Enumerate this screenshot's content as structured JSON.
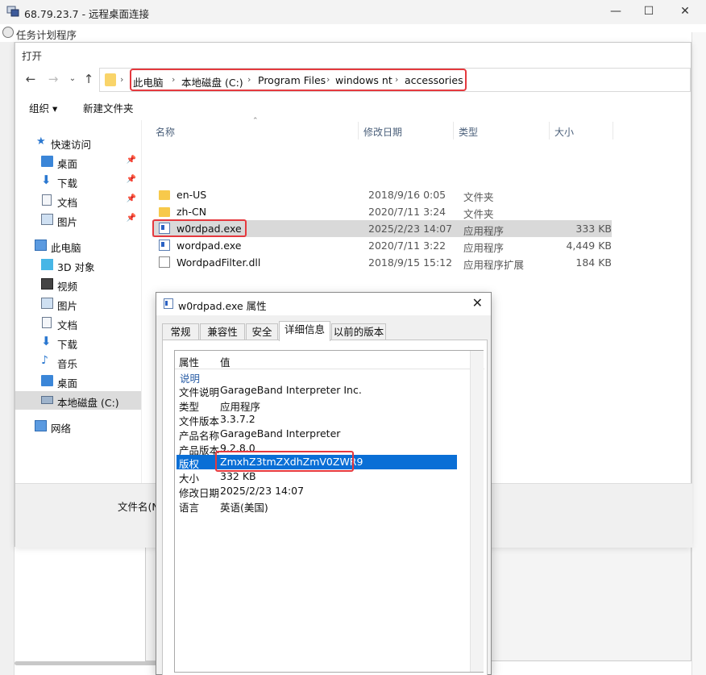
{
  "rdp": {
    "title": "68.79.23.7 - 远程桌面连接",
    "minimize": "—",
    "maximize": "☐",
    "close": "✕"
  },
  "bg_app": {
    "title": "任务计划程序"
  },
  "open_dialog": {
    "title": "打开",
    "breadcrumbs": [
      "此电脑",
      "本地磁盘 (C:)",
      "Program Files",
      "windows nt",
      "accessories"
    ],
    "toolbar": {
      "organize": "组织 ▾",
      "new_folder": "新建文件夹"
    },
    "nav": {
      "quick_access": "快速访问",
      "desktop": "桌面",
      "downloads": "下载",
      "documents": "文档",
      "pictures": "图片",
      "this_pc": "此电脑",
      "objects3d": "3D 对象",
      "videos": "视频",
      "pictures2": "图片",
      "documents2": "文档",
      "downloads2": "下载",
      "music": "音乐",
      "desktop2": "桌面",
      "local_disk": "本地磁盘 (C:)",
      "network": "网络"
    },
    "columns": {
      "name": "名称",
      "date": "修改日期",
      "type": "类型",
      "size": "大小"
    },
    "files": [
      {
        "name": "en-US",
        "date": "2018/9/16 0:05",
        "type": "文件夹",
        "size": ""
      },
      {
        "name": "zh-CN",
        "date": "2020/7/11 3:24",
        "type": "文件夹",
        "size": ""
      },
      {
        "name": "w0rdpad.exe",
        "date": "2025/2/23 14:07",
        "type": "应用程序",
        "size": "333 KB"
      },
      {
        "name": "wordpad.exe",
        "date": "2020/7/11 3:22",
        "type": "应用程序",
        "size": "4,449 KB"
      },
      {
        "name": "WordpadFilter.dll",
        "date": "2018/9/15 15:12",
        "type": "应用程序扩展",
        "size": "184 KB"
      }
    ],
    "filename_label": "文件名(N"
  },
  "props": {
    "title": "w0rdpad.exe 属性",
    "close": "✕",
    "tabs": [
      "常规",
      "兼容性",
      "安全",
      "详细信息",
      "以前的版本"
    ],
    "header": {
      "property": "属性",
      "value": "值"
    },
    "section": "说明",
    "rows": [
      {
        "k": "文件说明",
        "v": "GarageBand Interpreter Inc."
      },
      {
        "k": "类型",
        "v": "应用程序"
      },
      {
        "k": "文件版本",
        "v": "3.3.7.2"
      },
      {
        "k": "产品名称",
        "v": "GarageBand Interpreter"
      },
      {
        "k": "产品版本",
        "v": "9.2.8.0"
      },
      {
        "k": "版权",
        "v": "ZmxhZ3tmZXdhZmV0ZWR9"
      },
      {
        "k": "大小",
        "v": "332 KB"
      },
      {
        "k": "修改日期",
        "v": "2025/2/23 14:07"
      },
      {
        "k": "语言",
        "v": "英语(美国)"
      }
    ]
  }
}
